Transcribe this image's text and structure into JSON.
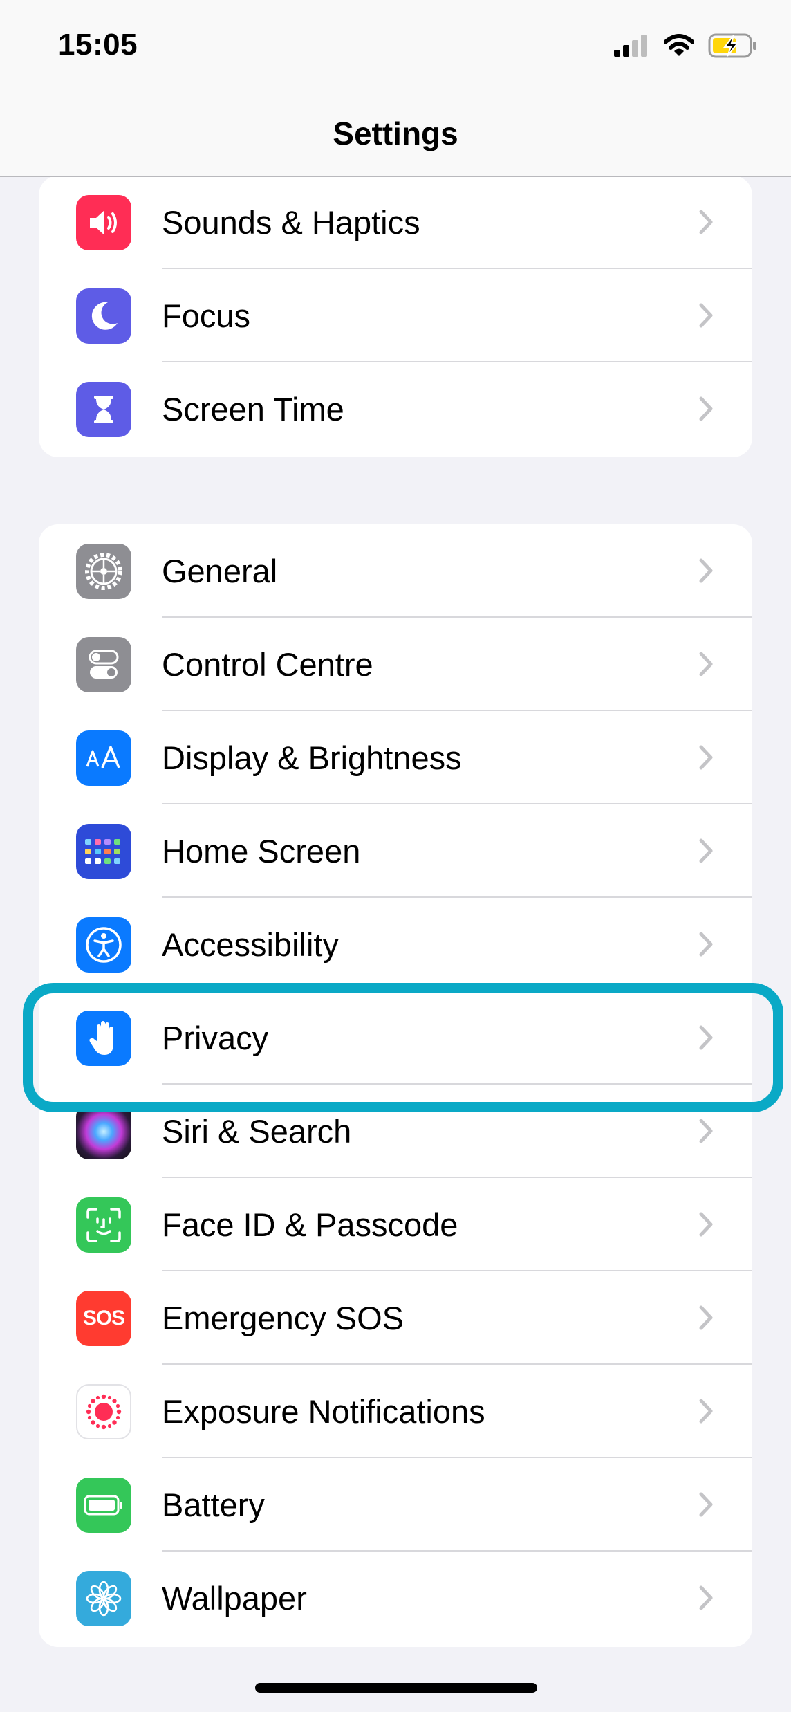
{
  "status_bar": {
    "time": "15:05",
    "icons": [
      "cellular-signal-icon",
      "wifi-icon",
      "battery-charging-icon"
    ]
  },
  "nav": {
    "title": "Settings"
  },
  "groups": [
    {
      "items": [
        {
          "label": "Sounds & Haptics",
          "icon": "speaker-icon",
          "color": "#ff2d55"
        },
        {
          "label": "Focus",
          "icon": "moon-icon",
          "color": "#5e5ce6"
        },
        {
          "label": "Screen Time",
          "icon": "hourglass-icon",
          "color": "#5e5ce6"
        }
      ]
    },
    {
      "items": [
        {
          "label": "General",
          "icon": "gear-icon",
          "color": "#8e8e93"
        },
        {
          "label": "Control Centre",
          "icon": "toggles-icon",
          "color": "#8e8e93"
        },
        {
          "label": "Display & Brightness",
          "icon": "text-size-icon",
          "color": "#0a7aff"
        },
        {
          "label": "Home Screen",
          "icon": "app-grid-icon",
          "color": "#2e4bd8"
        },
        {
          "label": "Accessibility",
          "icon": "accessibility-icon",
          "color": "#0a7aff"
        },
        {
          "label": "Privacy",
          "icon": "hand-icon",
          "color": "#0a7aff",
          "highlighted": true
        },
        {
          "label": "Siri & Search",
          "icon": "siri-icon",
          "color": "#222222"
        },
        {
          "label": "Face ID & Passcode",
          "icon": "face-id-icon",
          "color": "#34c759"
        },
        {
          "label": "Emergency SOS",
          "icon": "sos-icon",
          "color": "#ff3b30",
          "icon_text": "SOS"
        },
        {
          "label": "Exposure Notifications",
          "icon": "exposure-icon",
          "color": "#ffffff"
        },
        {
          "label": "Battery",
          "icon": "battery-icon",
          "color": "#34c759"
        },
        {
          "label": "Wallpaper",
          "icon": "flower-icon",
          "color": "#34aadc"
        }
      ]
    }
  ],
  "colors": {
    "highlight": "#0aa9c6",
    "background": "#f2f2f7",
    "chevron": "#c4c4c7"
  }
}
